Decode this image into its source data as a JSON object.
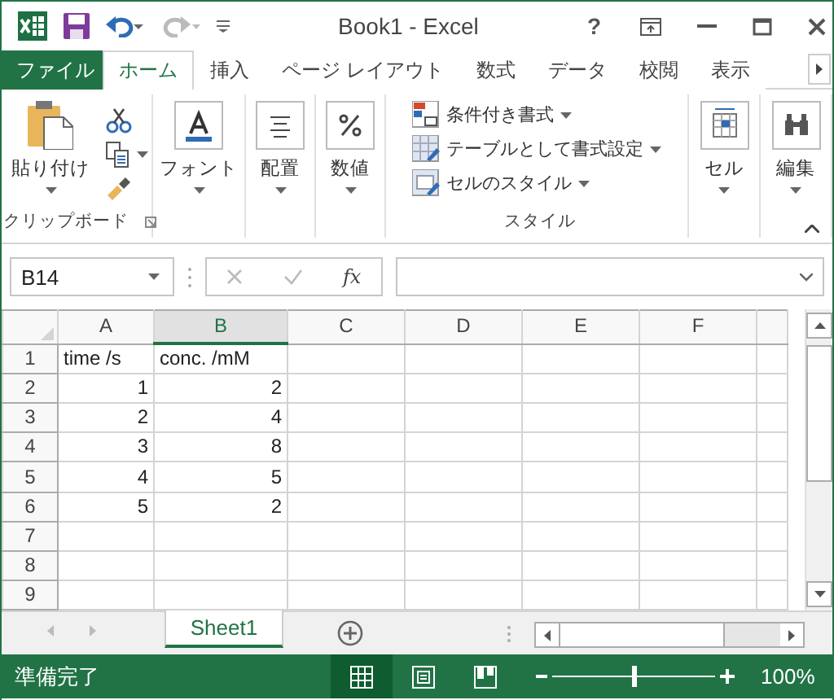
{
  "window": {
    "title": "Book1 - Excel",
    "help": "?"
  },
  "tabs": [
    {
      "label": "ファイル",
      "kind": "file",
      "selected": false
    },
    {
      "label": "ホーム",
      "kind": "tab",
      "selected": true
    },
    {
      "label": "挿入",
      "kind": "tab",
      "selected": false
    },
    {
      "label": "ページ レイアウト",
      "kind": "tab",
      "selected": false
    },
    {
      "label": "数式",
      "kind": "tab",
      "selected": false
    },
    {
      "label": "データ",
      "kind": "tab",
      "selected": false
    },
    {
      "label": "校閲",
      "kind": "tab",
      "selected": false
    },
    {
      "label": "表示",
      "kind": "tab",
      "selected": false
    }
  ],
  "ribbon": [
    {
      "kind": "clipboard",
      "label": "貼り付け",
      "title": "クリップボード"
    },
    {
      "kind": "big",
      "label": "フォント"
    },
    {
      "kind": "big",
      "label": "配置"
    },
    {
      "kind": "big",
      "label": "数値"
    },
    {
      "kind": "styles",
      "title": "スタイル",
      "items": [
        "条件付き書式",
        "テーブルとして書式設定",
        "セルのスタイル"
      ]
    },
    {
      "kind": "big",
      "label": "セル"
    },
    {
      "kind": "big",
      "label": "編集"
    }
  ],
  "formula_bar": {
    "name_box": "B14",
    "fx": "fx"
  },
  "grid": {
    "columns": [
      {
        "label": "A",
        "selected": false
      },
      {
        "label": "B",
        "selected": true
      },
      {
        "label": "C",
        "selected": false
      },
      {
        "label": "D",
        "selected": false
      },
      {
        "label": "E",
        "selected": false
      },
      {
        "label": "F",
        "selected": false
      }
    ],
    "rows": [
      {
        "header": "1",
        "cells": [
          {
            "value": "time /s",
            "kind": "text"
          },
          {
            "value": "conc. /mM",
            "kind": "text"
          }
        ]
      },
      {
        "header": "2",
        "cells": [
          {
            "value": "1",
            "kind": "number"
          },
          {
            "value": "2",
            "kind": "number"
          }
        ]
      },
      {
        "header": "3",
        "cells": [
          {
            "value": "2",
            "kind": "number"
          },
          {
            "value": "4",
            "kind": "number"
          }
        ]
      },
      {
        "header": "4",
        "cells": [
          {
            "value": "3",
            "kind": "number"
          },
          {
            "value": "8",
            "kind": "number"
          }
        ]
      },
      {
        "header": "5",
        "cells": [
          {
            "value": "4",
            "kind": "number"
          },
          {
            "value": "5",
            "kind": "number"
          }
        ]
      },
      {
        "header": "6",
        "cells": [
          {
            "value": "5",
            "kind": "number"
          },
          {
            "value": "2",
            "kind": "number"
          }
        ]
      },
      {
        "header": "7",
        "cells": []
      },
      {
        "header": "8",
        "cells": []
      },
      {
        "header": "9",
        "cells": []
      }
    ]
  },
  "sheets": [
    {
      "label": "Sheet1",
      "selected": true
    }
  ],
  "status_bar": {
    "text": "準備完了",
    "views": [
      {
        "kind": "normal",
        "selected": true
      },
      {
        "kind": "layout",
        "selected": false
      },
      {
        "kind": "pagebreak",
        "selected": false
      }
    ],
    "zoom": {
      "level": 0.5,
      "reading": "100%"
    }
  }
}
